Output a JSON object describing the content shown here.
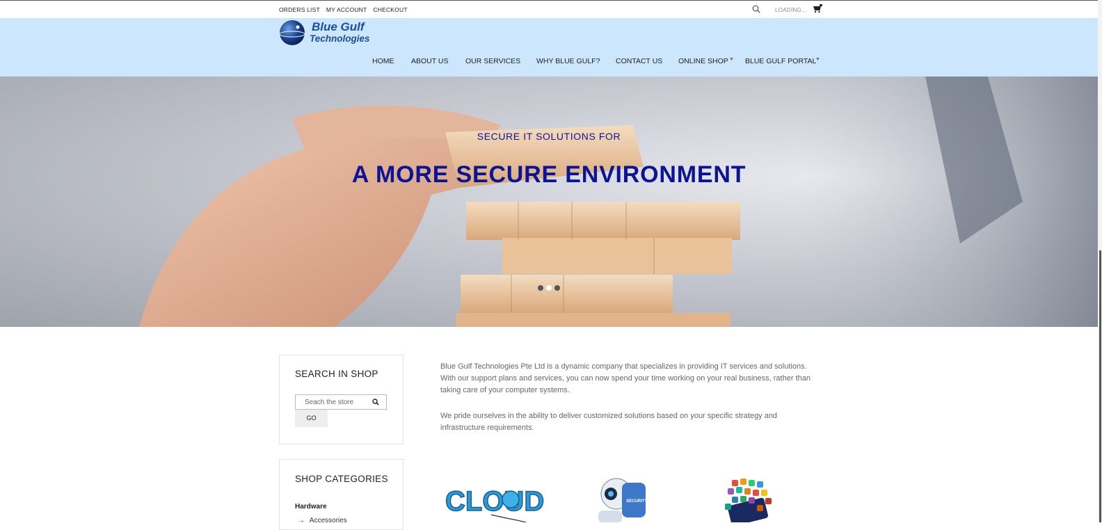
{
  "topbar": {
    "links": [
      "ORDERS LIST",
      "MY ACCOUNT",
      "CHECKOUT"
    ],
    "loading_text": "LOADING..."
  },
  "logo": {
    "line1": "Blue Gulf",
    "line2": "Technologies"
  },
  "nav": {
    "items": [
      {
        "label": "HOME"
      },
      {
        "label": "ABOUT US"
      },
      {
        "label": "OUR SERVICES"
      },
      {
        "label": "WHY BLUE GULF?"
      },
      {
        "label": "CONTACT US"
      },
      {
        "label": "ONLINE SHOP"
      },
      {
        "label": "BLUE GULF PORTAL"
      }
    ]
  },
  "hero": {
    "subtitle": "SECURE IT SOLUTIONS FOR",
    "title": "A MORE SECURE ENVIRONMENT",
    "slides": 3,
    "active_slide": 2
  },
  "sidebar": {
    "search": {
      "title": "SEARCH IN SHOP",
      "placeholder": "Seach the store",
      "button": "GO"
    },
    "categories": {
      "title": "SHOP CATEGORIES",
      "group": "Hardware",
      "item": "Accessories",
      "arrow": "→"
    }
  },
  "content": {
    "p1": "Blue Gulf Technologies Pte Ltd is a dynamic company that specializes in providing IT services and solutions. With our support plans and services, you can now spend your time working on your real business, rather than taking care of your computer systems.",
    "p2": "We pride ourselves in the ability to deliver customized solutions based on your specific strategy and infrastructure requirements.",
    "features": [
      "cloud",
      "security",
      "apps"
    ],
    "cloud_label": "CLOUD",
    "security_label": "SECURITY"
  },
  "colors": {
    "header_bg": "#cce6fd",
    "hero_text": "#0c1496",
    "logo_blue": "#1a4f9c"
  }
}
